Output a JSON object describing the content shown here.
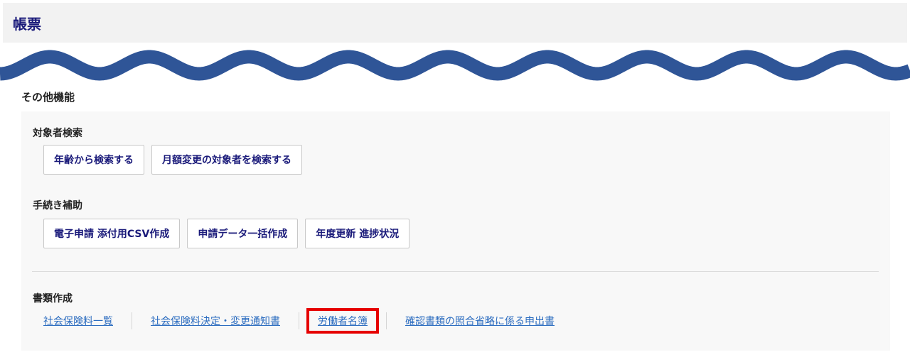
{
  "header": {
    "title": "帳票"
  },
  "section": {
    "title": "その他機能"
  },
  "groups": {
    "search": {
      "title": "対象者検索",
      "buttons": [
        "年齢から検索する",
        "月額変更の対象者を検索する"
      ]
    },
    "procedure": {
      "title": "手続き補助",
      "buttons": [
        "電子申請 添付用CSV作成",
        "申請データ一括作成",
        "年度更新 進捗状況"
      ]
    },
    "documents": {
      "title": "書類作成",
      "links": [
        "社会保険料一覧",
        "社会保険料決定・変更通知書",
        "労働者名簿",
        "確認書類の照合省略に係る申出書"
      ]
    }
  },
  "colors": {
    "accent": "#1a1a7a",
    "link": "#2a6bbf",
    "highlight": "#e60000",
    "wave": "#2f5597"
  }
}
